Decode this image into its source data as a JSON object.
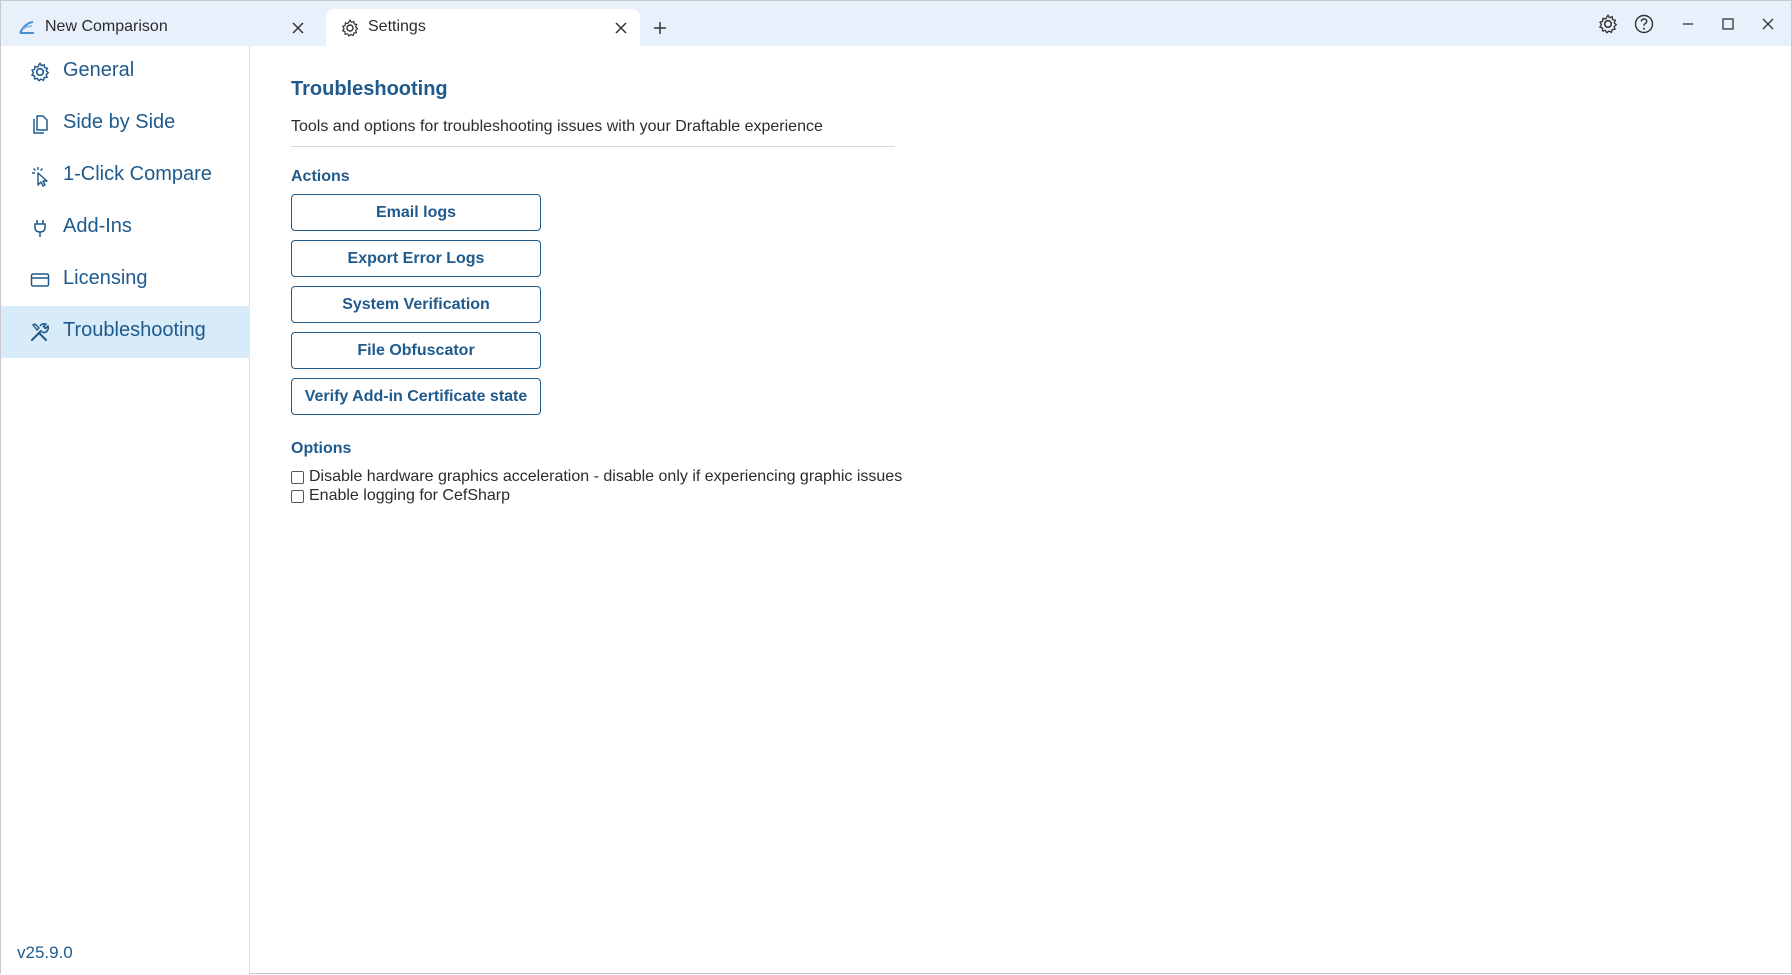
{
  "tabs": [
    {
      "label": "New Comparison",
      "icon": "draftable-logo-icon"
    },
    {
      "label": "Settings",
      "icon": "gear-icon",
      "active": true
    }
  ],
  "window_controls": [
    "gear-icon",
    "help-icon",
    "minimize-icon",
    "maximize-icon",
    "close-icon"
  ],
  "sidebar": {
    "items": [
      {
        "label": "General",
        "icon": "gear-icon"
      },
      {
        "label": "Side by Side",
        "icon": "document-copy-icon"
      },
      {
        "label": "1-Click Compare",
        "icon": "cursor-click-icon"
      },
      {
        "label": "Add-Ins",
        "icon": "plug-icon"
      },
      {
        "label": "Licensing",
        "icon": "credit-card-icon"
      },
      {
        "label": "Troubleshooting",
        "icon": "tools-icon",
        "active": true
      }
    ],
    "version": "v25.9.0"
  },
  "main": {
    "title": "Troubleshooting",
    "description": "Tools and options for troubleshooting issues with your Draftable experience",
    "actions_title": "Actions",
    "actions": [
      "Email logs",
      "Export Error Logs",
      "System Verification",
      "File Obfuscator",
      "Verify Add-in Certificate state"
    ],
    "options_title": "Options",
    "options": [
      {
        "label": "Disable hardware graphics acceleration - disable only if experiencing graphic issues",
        "checked": false
      },
      {
        "label": "Enable logging for CefSharp",
        "checked": false
      }
    ]
  },
  "colors": {
    "accent": "#1f5a8c",
    "titlebar": "#e8f1fb",
    "active_nav": "#d8ebf8"
  }
}
